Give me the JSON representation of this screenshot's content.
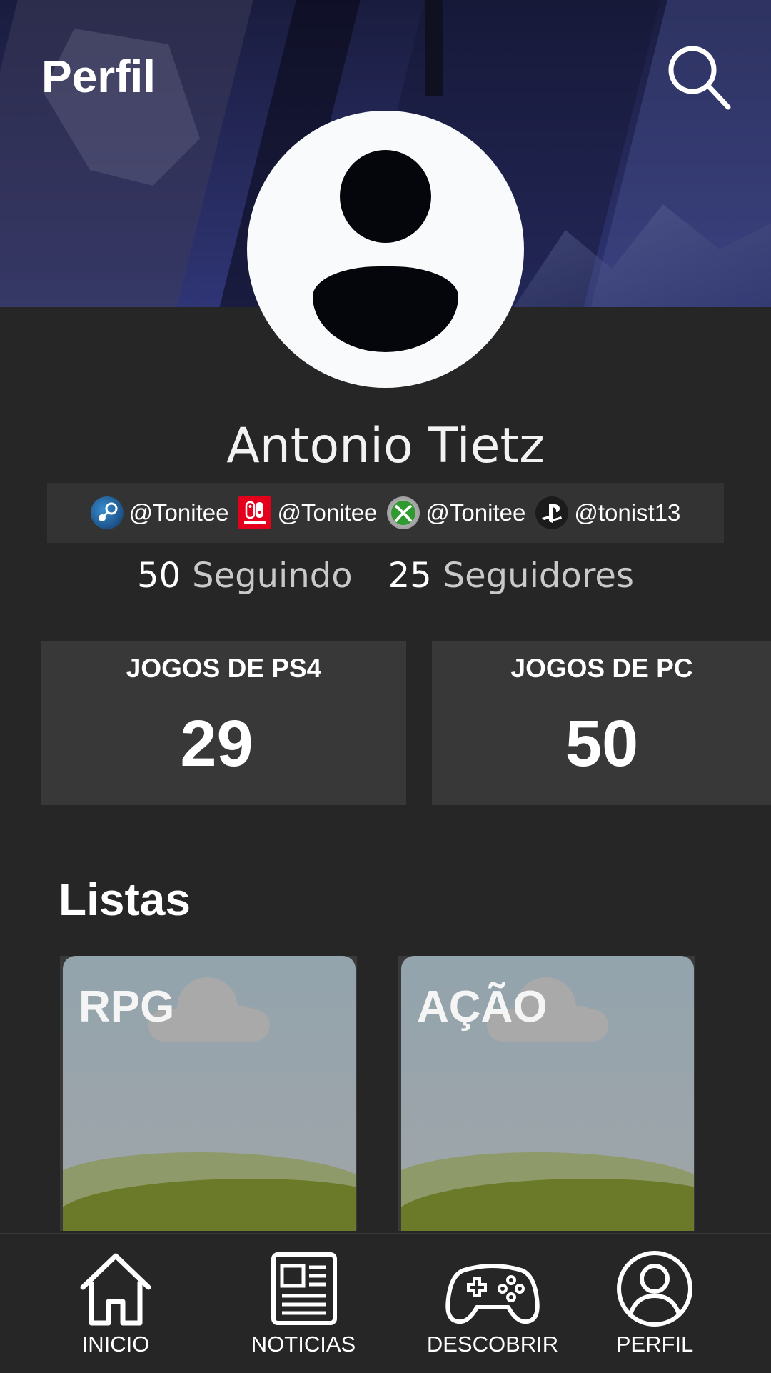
{
  "header": {
    "title": "Perfil"
  },
  "profile": {
    "name": "Antonio Tietz",
    "handles": [
      {
        "platform_icon": "steam-icon",
        "handle": "@Tonitee"
      },
      {
        "platform_icon": "nintendo-switch-icon",
        "handle": "@Tonitee"
      },
      {
        "platform_icon": "xbox-icon",
        "handle": "@Tonitee"
      },
      {
        "platform_icon": "playstation-icon",
        "handle": "@tonist13"
      }
    ],
    "following_count": "50",
    "following_label": "Seguindo",
    "followers_count": "25",
    "followers_label": "Seguidores"
  },
  "stats": [
    {
      "label": "JOGOS DE PS4",
      "value": "29"
    },
    {
      "label": "JOGOS DE PC",
      "value": "50"
    }
  ],
  "lists": {
    "title": "Listas",
    "items": [
      {
        "label": "RPG"
      },
      {
        "label": "AÇÃO"
      }
    ]
  },
  "nav": {
    "items": [
      {
        "label": "INICIO",
        "icon": "home-icon"
      },
      {
        "label": "NOTICIAS",
        "icon": "newspaper-icon"
      },
      {
        "label": "DESCOBRIR",
        "icon": "gamepad-icon"
      },
      {
        "label": "PERFIL",
        "icon": "profile-icon"
      }
    ]
  },
  "colors": {
    "background": "#262626",
    "card": "#383838",
    "handles_bar": "#333333",
    "switch_red": "#e4001c"
  }
}
